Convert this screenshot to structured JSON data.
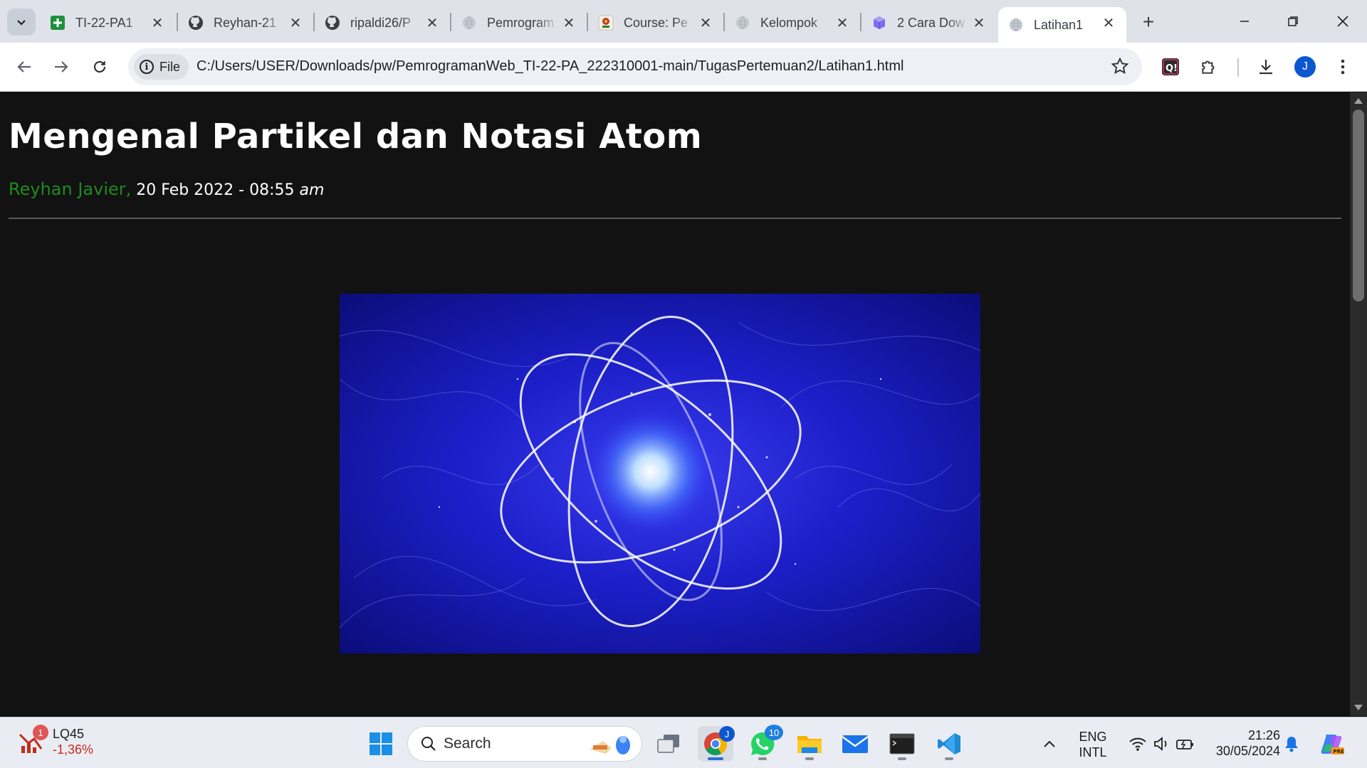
{
  "browser": {
    "tabs": [
      {
        "title": "TI-22-PA1",
        "icon": "sheets-plus-icon"
      },
      {
        "title": "Reyhan-21",
        "icon": "github-icon"
      },
      {
        "title": "ripaldi26/P",
        "icon": "github-icon"
      },
      {
        "title": "Pemrogram",
        "icon": "globe-icon"
      },
      {
        "title": "Course: Pe",
        "icon": "moodle-icon"
      },
      {
        "title": "Kelompok",
        "icon": "globe-icon"
      },
      {
        "title": "2 Cara Dow",
        "icon": "cube-icon"
      },
      {
        "title": "Latihan1",
        "icon": "globe-icon",
        "active": true
      }
    ],
    "address": {
      "chip_label": "File",
      "url": "C:/Users/USER/Downloads/pw/PemrogramanWeb_TI-22-PA_222310001-main/TugasPertemuan2/Latihan1.html"
    },
    "profile_initial": "J"
  },
  "page": {
    "title": "Mengenal Partikel dan Notasi Atom",
    "author": "Reyhan Javier,",
    "date": "20 Feb 2022 - 08:55",
    "ampm": "am",
    "colors": {
      "background": "#121212",
      "author": "#1f8a1f",
      "title": "#ffffff"
    },
    "image": {
      "subject": "atom-illustration-blue"
    }
  },
  "taskbar": {
    "stock": {
      "name": "LQ45",
      "change": "-1,36%",
      "badge": "1"
    },
    "search_label": "Search",
    "whatsapp_badge": "10",
    "chrome_profile": "J",
    "language": {
      "line1": "ENG",
      "line2": "INTL"
    },
    "time": "21:26",
    "date": "30/05/2024"
  }
}
